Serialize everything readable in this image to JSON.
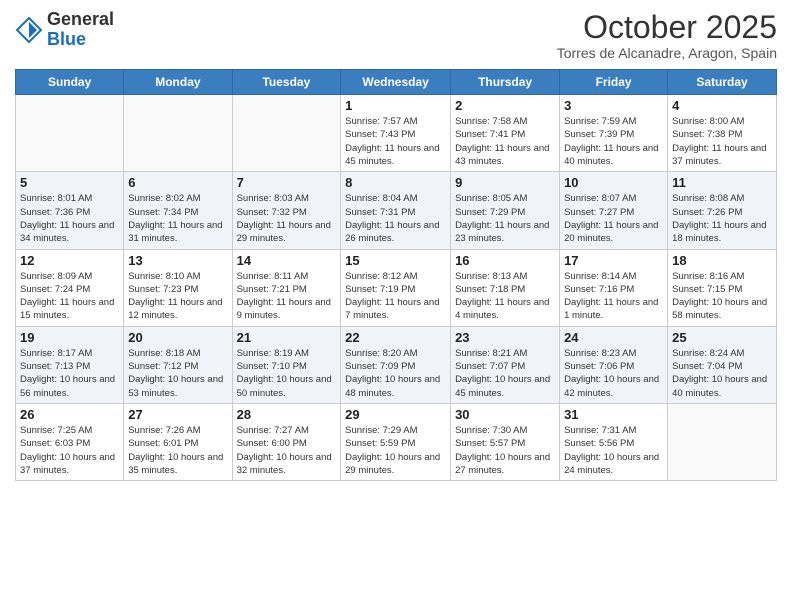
{
  "logo": {
    "general": "General",
    "blue": "Blue"
  },
  "header": {
    "month": "October 2025",
    "location": "Torres de Alcanadre, Aragon, Spain"
  },
  "weekdays": [
    "Sunday",
    "Monday",
    "Tuesday",
    "Wednesday",
    "Thursday",
    "Friday",
    "Saturday"
  ],
  "weeks": [
    [
      {
        "day": "",
        "info": ""
      },
      {
        "day": "",
        "info": ""
      },
      {
        "day": "",
        "info": ""
      },
      {
        "day": "1",
        "info": "Sunrise: 7:57 AM\nSunset: 7:43 PM\nDaylight: 11 hours and 45 minutes."
      },
      {
        "day": "2",
        "info": "Sunrise: 7:58 AM\nSunset: 7:41 PM\nDaylight: 11 hours and 43 minutes."
      },
      {
        "day": "3",
        "info": "Sunrise: 7:59 AM\nSunset: 7:39 PM\nDaylight: 11 hours and 40 minutes."
      },
      {
        "day": "4",
        "info": "Sunrise: 8:00 AM\nSunset: 7:38 PM\nDaylight: 11 hours and 37 minutes."
      }
    ],
    [
      {
        "day": "5",
        "info": "Sunrise: 8:01 AM\nSunset: 7:36 PM\nDaylight: 11 hours and 34 minutes."
      },
      {
        "day": "6",
        "info": "Sunrise: 8:02 AM\nSunset: 7:34 PM\nDaylight: 11 hours and 31 minutes."
      },
      {
        "day": "7",
        "info": "Sunrise: 8:03 AM\nSunset: 7:32 PM\nDaylight: 11 hours and 29 minutes."
      },
      {
        "day": "8",
        "info": "Sunrise: 8:04 AM\nSunset: 7:31 PM\nDaylight: 11 hours and 26 minutes."
      },
      {
        "day": "9",
        "info": "Sunrise: 8:05 AM\nSunset: 7:29 PM\nDaylight: 11 hours and 23 minutes."
      },
      {
        "day": "10",
        "info": "Sunrise: 8:07 AM\nSunset: 7:27 PM\nDaylight: 11 hours and 20 minutes."
      },
      {
        "day": "11",
        "info": "Sunrise: 8:08 AM\nSunset: 7:26 PM\nDaylight: 11 hours and 18 minutes."
      }
    ],
    [
      {
        "day": "12",
        "info": "Sunrise: 8:09 AM\nSunset: 7:24 PM\nDaylight: 11 hours and 15 minutes."
      },
      {
        "day": "13",
        "info": "Sunrise: 8:10 AM\nSunset: 7:23 PM\nDaylight: 11 hours and 12 minutes."
      },
      {
        "day": "14",
        "info": "Sunrise: 8:11 AM\nSunset: 7:21 PM\nDaylight: 11 hours and 9 minutes."
      },
      {
        "day": "15",
        "info": "Sunrise: 8:12 AM\nSunset: 7:19 PM\nDaylight: 11 hours and 7 minutes."
      },
      {
        "day": "16",
        "info": "Sunrise: 8:13 AM\nSunset: 7:18 PM\nDaylight: 11 hours and 4 minutes."
      },
      {
        "day": "17",
        "info": "Sunrise: 8:14 AM\nSunset: 7:16 PM\nDaylight: 11 hours and 1 minute."
      },
      {
        "day": "18",
        "info": "Sunrise: 8:16 AM\nSunset: 7:15 PM\nDaylight: 10 hours and 58 minutes."
      }
    ],
    [
      {
        "day": "19",
        "info": "Sunrise: 8:17 AM\nSunset: 7:13 PM\nDaylight: 10 hours and 56 minutes."
      },
      {
        "day": "20",
        "info": "Sunrise: 8:18 AM\nSunset: 7:12 PM\nDaylight: 10 hours and 53 minutes."
      },
      {
        "day": "21",
        "info": "Sunrise: 8:19 AM\nSunset: 7:10 PM\nDaylight: 10 hours and 50 minutes."
      },
      {
        "day": "22",
        "info": "Sunrise: 8:20 AM\nSunset: 7:09 PM\nDaylight: 10 hours and 48 minutes."
      },
      {
        "day": "23",
        "info": "Sunrise: 8:21 AM\nSunset: 7:07 PM\nDaylight: 10 hours and 45 minutes."
      },
      {
        "day": "24",
        "info": "Sunrise: 8:23 AM\nSunset: 7:06 PM\nDaylight: 10 hours and 42 minutes."
      },
      {
        "day": "25",
        "info": "Sunrise: 8:24 AM\nSunset: 7:04 PM\nDaylight: 10 hours and 40 minutes."
      }
    ],
    [
      {
        "day": "26",
        "info": "Sunrise: 7:25 AM\nSunset: 6:03 PM\nDaylight: 10 hours and 37 minutes."
      },
      {
        "day": "27",
        "info": "Sunrise: 7:26 AM\nSunset: 6:01 PM\nDaylight: 10 hours and 35 minutes."
      },
      {
        "day": "28",
        "info": "Sunrise: 7:27 AM\nSunset: 6:00 PM\nDaylight: 10 hours and 32 minutes."
      },
      {
        "day": "29",
        "info": "Sunrise: 7:29 AM\nSunset: 5:59 PM\nDaylight: 10 hours and 29 minutes."
      },
      {
        "day": "30",
        "info": "Sunrise: 7:30 AM\nSunset: 5:57 PM\nDaylight: 10 hours and 27 minutes."
      },
      {
        "day": "31",
        "info": "Sunrise: 7:31 AM\nSunset: 5:56 PM\nDaylight: 10 hours and 24 minutes."
      },
      {
        "day": "",
        "info": ""
      }
    ]
  ]
}
